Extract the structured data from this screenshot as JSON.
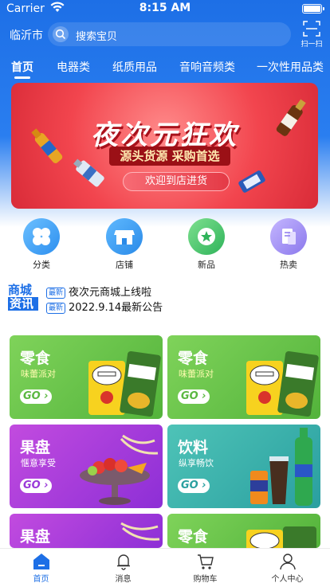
{
  "status_bar": {
    "carrier": "Carrier",
    "time": "8:15 AM"
  },
  "header": {
    "city": "临沂市",
    "search_placeholder": "搜索宝贝",
    "scan_label": "扫一扫"
  },
  "tabs": [
    "首页",
    "电器类",
    "纸质用品",
    "音响音频类",
    "一次性用品类"
  ],
  "banner": {
    "headline": "夜次元狂欢",
    "subline": "源头货源 采购首选",
    "welcome": "欢迎到店进货"
  },
  "quick_nav": [
    {
      "label": "分类",
      "icon": "clover-icon",
      "color": "#3aa0f5"
    },
    {
      "label": "店铺",
      "icon": "store-icon",
      "color": "#2f9cf2"
    },
    {
      "label": "新品",
      "icon": "star-icon",
      "color": "#3fc26a"
    },
    {
      "label": "热卖",
      "icon": "document-icon",
      "color": "#9b88f0"
    }
  ],
  "notice": {
    "badge_line1": "商城",
    "badge_line2": "资讯",
    "items": [
      {
        "tag": "最新",
        "text": "夜次元商城上线啦"
      },
      {
        "tag": "最新",
        "text": "2022.9.14最新公告"
      }
    ]
  },
  "cards": [
    {
      "title": "零食",
      "subtitle": "味蕾派对",
      "go": "GO",
      "theme": "green"
    },
    {
      "title": "零食",
      "subtitle": "味蕾派对",
      "go": "GO",
      "theme": "green"
    },
    {
      "title": "果盘",
      "subtitle": "惬意享受",
      "go": "GO",
      "theme": "purple"
    },
    {
      "title": "饮料",
      "subtitle": "纵享畅饮",
      "go": "GO",
      "theme": "teal"
    },
    {
      "title": "果盘",
      "theme": "purple"
    },
    {
      "title": "零食",
      "theme": "green"
    }
  ],
  "tabbar": [
    {
      "label": "首页",
      "icon": "home-icon"
    },
    {
      "label": "消息",
      "icon": "bell-icon"
    },
    {
      "label": "购物车",
      "icon": "cart-icon"
    },
    {
      "label": "个人中心",
      "icon": "person-icon"
    }
  ],
  "colors": {
    "brand_blue": "#1d6fe6",
    "banner_red": "#f2454e"
  }
}
